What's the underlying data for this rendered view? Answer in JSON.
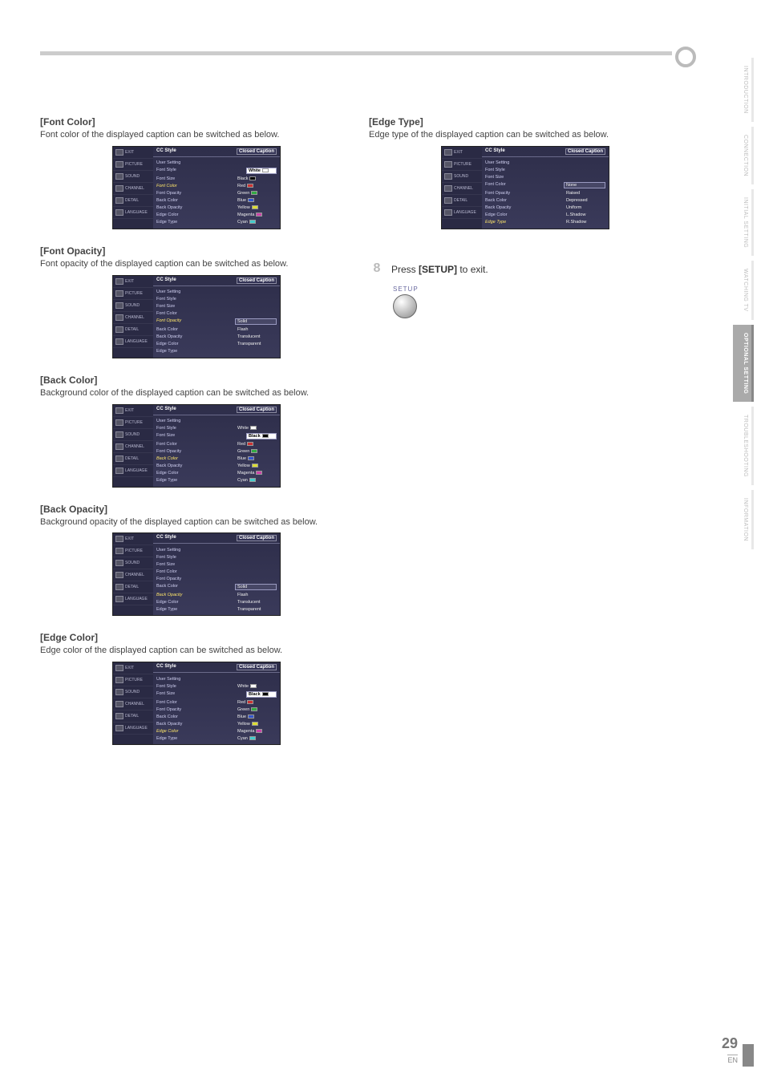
{
  "side_tabs": [
    "INTRODUCTION",
    "CONNECTION",
    "INITIAL SETTING",
    "WATCHING TV",
    "OPTIONAL SETTING",
    "TROUBLESHOOTING",
    "INFORMATION"
  ],
  "side_active_index": 4,
  "osd_common": {
    "header_left": "CC Style",
    "header_right": "Closed Caption",
    "nav": [
      "EXIT",
      "PICTURE",
      "SOUND",
      "CHANNEL",
      "DETAIL",
      "LANGUAGE"
    ]
  },
  "left_sections": [
    {
      "title": "[Font Color]",
      "desc": "Font color of the displayed caption can be switched as below.",
      "highlight": "Font Color",
      "rows": [
        {
          "l": "User Setting"
        },
        {
          "l": "Font Style",
          "v": "White",
          "sw": "#ffffff",
          "selw": true
        },
        {
          "l": "Font Size",
          "v": "Black",
          "sw": "#000000"
        },
        {
          "l": "Font Color",
          "v": "Red",
          "sw": "#cc3333",
          "hl": true
        },
        {
          "l": "Font Opacity",
          "v": "Green",
          "sw": "#33aa44"
        },
        {
          "l": "Back Color",
          "v": "Blue",
          "sw": "#3355cc"
        },
        {
          "l": "Back Opacity",
          "v": "Yellow",
          "sw": "#dddd33"
        },
        {
          "l": "Edge Color",
          "v": "Magenta",
          "sw": "#cc44aa"
        },
        {
          "l": "Edge Type",
          "v": "Cyan",
          "sw": "#44cccc"
        }
      ]
    },
    {
      "title": "[Font Opacity]",
      "desc": "Font opacity of the displayed caption can be switched as below.",
      "highlight": "Font Opacity",
      "rows": [
        {
          "l": "User Setting"
        },
        {
          "l": "Font Style"
        },
        {
          "l": "Font Size"
        },
        {
          "l": "Font Color"
        },
        {
          "l": "Font Opacity",
          "v": "Solid",
          "sel": true,
          "hl": true
        },
        {
          "l": "Back Color",
          "v": "Flash"
        },
        {
          "l": "Back Opacity",
          "v": "Translucent"
        },
        {
          "l": "Edge Color",
          "v": "Transparent"
        },
        {
          "l": "Edge Type"
        }
      ]
    },
    {
      "title": "[Back Color]",
      "desc": "Background color of the displayed caption can be switched as below.",
      "highlight": "Back Color",
      "rows": [
        {
          "l": "User Setting"
        },
        {
          "l": "Font Style",
          "v": "White",
          "sw": "#ffffff"
        },
        {
          "l": "Font Size",
          "v": "Black",
          "sw": "#000000",
          "selw": true
        },
        {
          "l": "Font Color",
          "v": "Red",
          "sw": "#cc3333"
        },
        {
          "l": "Font Opacity",
          "v": "Green",
          "sw": "#33aa44"
        },
        {
          "l": "Back Color",
          "v": "Blue",
          "sw": "#3355cc",
          "hl": true
        },
        {
          "l": "Back Opacity",
          "v": "Yellow",
          "sw": "#dddd33"
        },
        {
          "l": "Edge Color",
          "v": "Magenta",
          "sw": "#cc44aa"
        },
        {
          "l": "Edge Type",
          "v": "Cyan",
          "sw": "#44cccc"
        }
      ]
    },
    {
      "title": "[Back Opacity]",
      "desc": "Background opacity of the displayed caption can be switched as below.",
      "highlight": "Back Opacity",
      "rows": [
        {
          "l": "User Setting"
        },
        {
          "l": "Font Style"
        },
        {
          "l": "Font Size"
        },
        {
          "l": "Font Color"
        },
        {
          "l": "Font Opacity"
        },
        {
          "l": "Back Color",
          "v": "Solid",
          "sel": true
        },
        {
          "l": "Back Opacity",
          "v": "Flash",
          "hl": true
        },
        {
          "l": "Edge Color",
          "v": "Translucent"
        },
        {
          "l": "Edge Type",
          "v": "Transparent"
        }
      ]
    },
    {
      "title": "[Edge Color]",
      "desc": "Edge color of the displayed caption can be switched as below.",
      "highlight": "Edge Color",
      "rows": [
        {
          "l": "User Setting"
        },
        {
          "l": "Font Style",
          "v": "White",
          "sw": "#ffffff"
        },
        {
          "l": "Font Size",
          "v": "Black",
          "sw": "#000000",
          "selw": true
        },
        {
          "l": "Font Color",
          "v": "Red",
          "sw": "#cc3333"
        },
        {
          "l": "Font Opacity",
          "v": "Green",
          "sw": "#33aa44"
        },
        {
          "l": "Back Color",
          "v": "Blue",
          "sw": "#3355cc"
        },
        {
          "l": "Back Opacity",
          "v": "Yellow",
          "sw": "#dddd33"
        },
        {
          "l": "Edge Color",
          "v": "Magenta",
          "sw": "#cc44aa",
          "hl": true
        },
        {
          "l": "Edge Type",
          "v": "Cyan",
          "sw": "#44cccc"
        }
      ]
    }
  ],
  "right_sections": [
    {
      "title": "[Edge Type]",
      "desc": "Edge type of the displayed caption can be switched as below.",
      "highlight": "Edge Type",
      "rows": [
        {
          "l": "User Setting"
        },
        {
          "l": "Font Style"
        },
        {
          "l": "Font Size"
        },
        {
          "l": "Font Color",
          "v": "None",
          "sel": true
        },
        {
          "l": "Font Opacity",
          "v": "Raised"
        },
        {
          "l": "Back Color",
          "v": "Depressed"
        },
        {
          "l": "Back Opacity",
          "v": "Uniform"
        },
        {
          "l": "Edge Color",
          "v": "L.Shadow"
        },
        {
          "l": "Edge Type",
          "v": "R.Shadow",
          "hl": true
        }
      ]
    }
  ],
  "step": {
    "num": "8",
    "text_pre": "Press ",
    "text_bold": "[SETUP]",
    "text_post": " to exit.",
    "label": "SETUP"
  },
  "footer": {
    "page": "29",
    "en": "EN"
  }
}
